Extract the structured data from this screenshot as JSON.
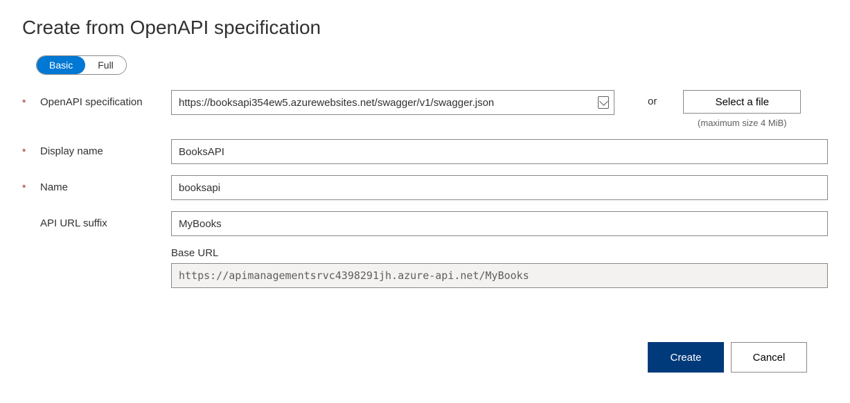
{
  "title": "Create from OpenAPI specification",
  "toggle": {
    "basic": "Basic",
    "full": "Full"
  },
  "labels": {
    "spec": "OpenAPI specification",
    "display_name": "Display name",
    "name": "Name",
    "suffix": "API URL suffix",
    "base_url": "Base URL"
  },
  "values": {
    "spec": "https://booksapi354ew5.azurewebsites.net/swagger/v1/swagger.json",
    "display_name": "BooksAPI",
    "name": "booksapi",
    "suffix": "MyBooks",
    "base_url": "https://apimanagementsrvc4398291jh.azure-api.net/MyBooks"
  },
  "or": "or",
  "select_file": "Select a file",
  "max_hint": "(maximum size 4 MiB)",
  "buttons": {
    "create": "Create",
    "cancel": "Cancel"
  }
}
